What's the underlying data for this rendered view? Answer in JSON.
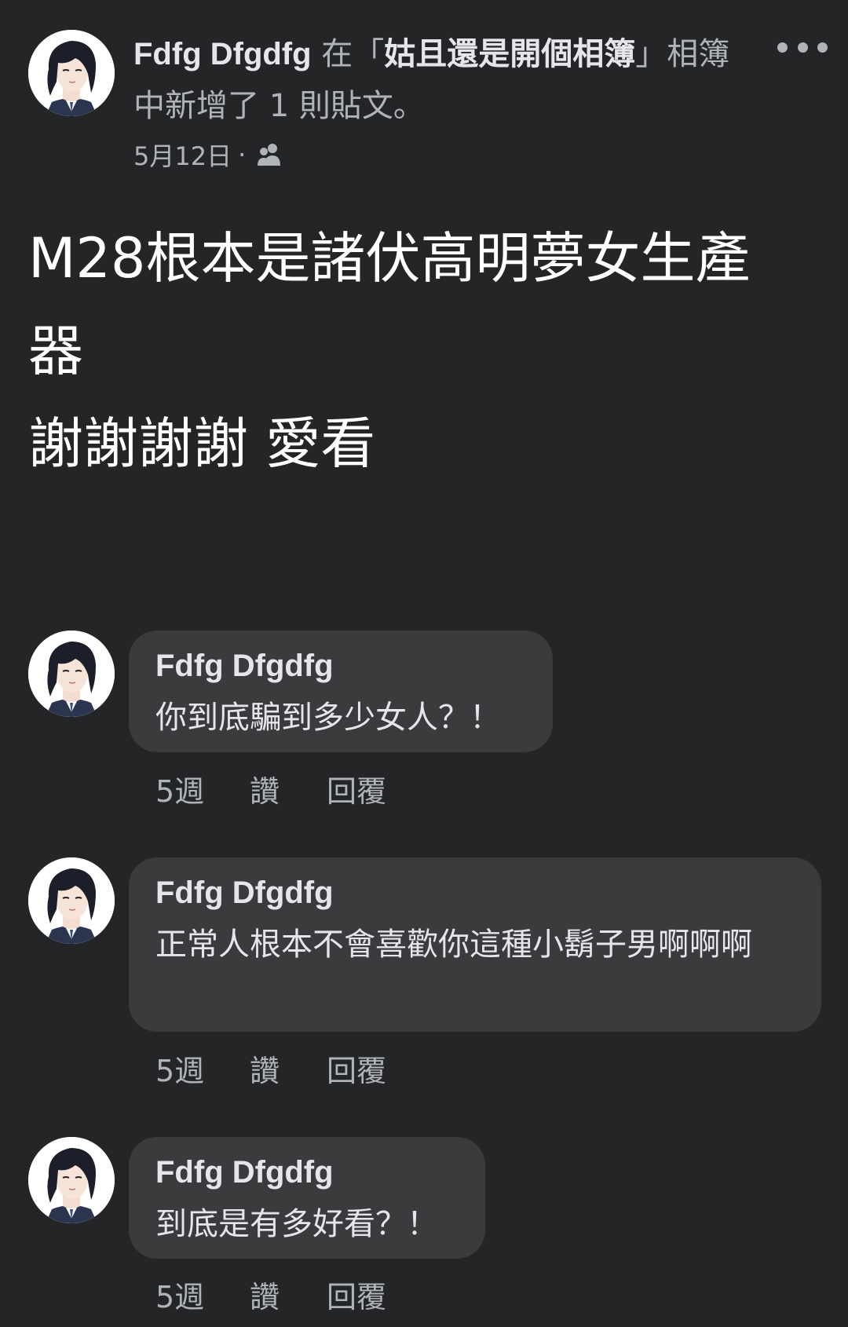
{
  "post": {
    "author": "Fdfg Dfgdfg",
    "header_pre": " 在「",
    "album_name": "姑且還是開個相簿",
    "header_post": "」相簿中新增了 1 則貼文。",
    "date": "5月12日",
    "dot": "·",
    "privacy_icon": "friends-icon",
    "text_lines": [
      "M28根本是諸伏高明夢女生產",
      "器",
      "謝謝謝謝 愛看"
    ]
  },
  "comments": [
    {
      "author": "Fdfg Dfgdfg",
      "text": "你到底騙到多少女人？！",
      "time": "5週",
      "like_label": "讚",
      "reply_label": "回覆"
    },
    {
      "author": "Fdfg Dfgdfg",
      "text": "正常人根本不會喜歡你這種小鬍子男啊啊啊",
      "time": "5週",
      "like_label": "讚",
      "reply_label": "回覆"
    },
    {
      "author": "Fdfg Dfgdfg",
      "text": "到底是有多好看？！",
      "time": "5週",
      "like_label": "讚",
      "reply_label": "回覆"
    }
  ],
  "colors": {
    "background": "#242527",
    "bubble": "#3a3b3c",
    "primary_text": "#e4e6eb",
    "secondary_text": "#b0b3b8"
  }
}
